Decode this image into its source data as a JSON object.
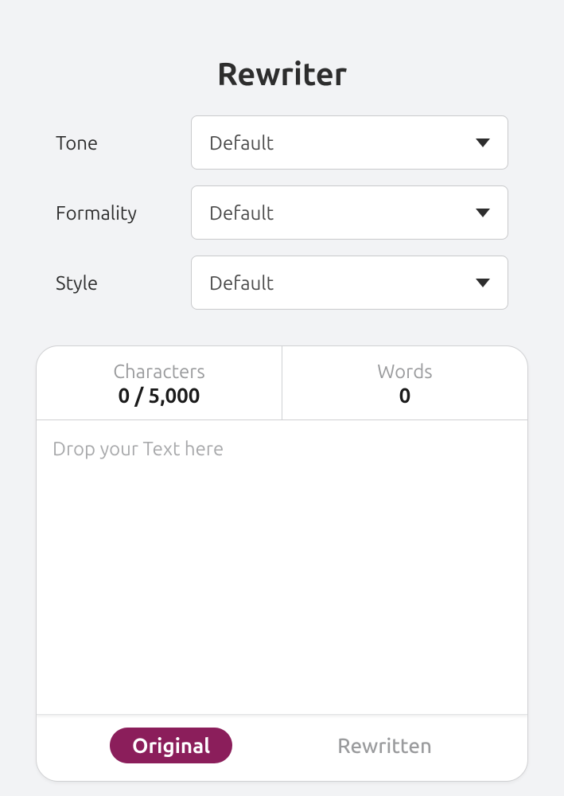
{
  "header": {
    "title": "Rewriter"
  },
  "controls": {
    "tone": {
      "label": "Tone",
      "value": "Default"
    },
    "formality": {
      "label": "Formality",
      "value": "Default"
    },
    "style": {
      "label": "Style",
      "value": "Default"
    }
  },
  "stats": {
    "characters": {
      "label": "Characters",
      "value": "0 / 5,000"
    },
    "words": {
      "label": "Words",
      "value": "0"
    }
  },
  "editor": {
    "placeholder": "Drop your Text here"
  },
  "tabs": {
    "original": "Original",
    "rewritten": "Rewritten"
  }
}
